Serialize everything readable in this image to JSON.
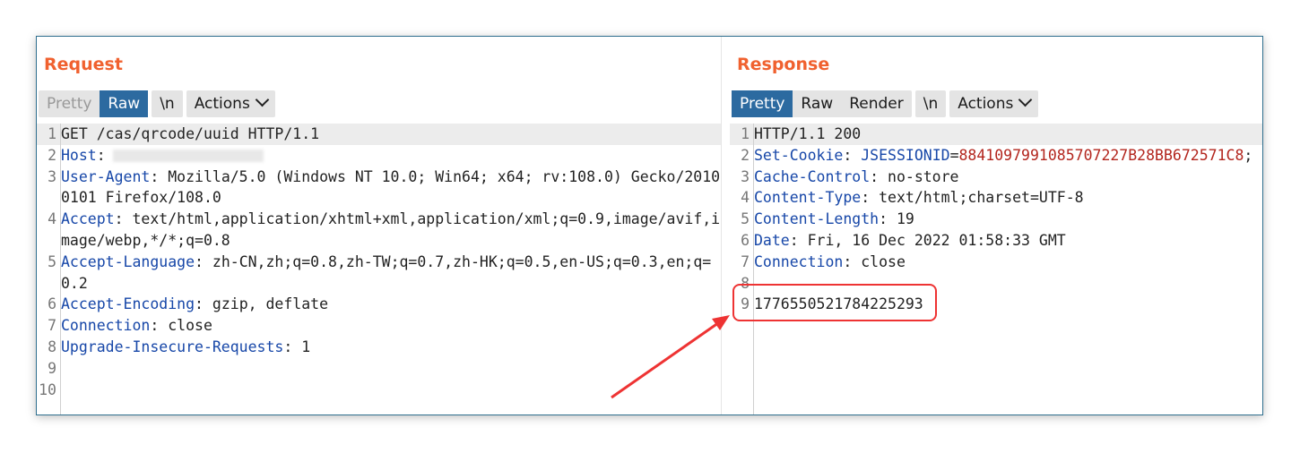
{
  "request": {
    "title": "Request",
    "buttons": {
      "pretty": "Pretty",
      "raw": "Raw",
      "newline": "\\n",
      "actions": "Actions"
    },
    "lines": [
      {
        "num": "1",
        "name": "",
        "sep": "",
        "value": "GET /cas/qrcode/uuid HTTP/1.1"
      },
      {
        "num": "2",
        "name": "Host",
        "sep": ":",
        "value": ""
      },
      {
        "num": "3",
        "name": "User-Agent",
        "sep": ":",
        "value": " Mozilla/5.0 (Windows NT 10.0; Win64; x64; rv:108.0) Gecko/20100101 Firefox/108.0"
      },
      {
        "num": "4",
        "name": "Accept",
        "sep": ":",
        "value": " text/html,application/xhtml+xml,application/xml;q=0.9,image/avif,image/webp,*/*;q=0.8"
      },
      {
        "num": "5",
        "name": "Accept-Language",
        "sep": ":",
        "value": " zh-CN,zh;q=0.8,zh-TW;q=0.7,zh-HK;q=0.5,en-US;q=0.3,en;q=0.2"
      },
      {
        "num": "6",
        "name": "Accept-Encoding",
        "sep": ":",
        "value": " gzip, deflate"
      },
      {
        "num": "7",
        "name": "Connection",
        "sep": ":",
        "value": " close"
      },
      {
        "num": "8",
        "name": "Upgrade-Insecure-Requests",
        "sep": ":",
        "value": " 1"
      },
      {
        "num": "9",
        "name": "",
        "sep": "",
        "value": ""
      },
      {
        "num": "10",
        "name": "",
        "sep": "",
        "value": ""
      }
    ]
  },
  "response": {
    "title": "Response",
    "buttons": {
      "pretty": "Pretty",
      "raw": "Raw",
      "render": "Render",
      "newline": "\\n",
      "actions": "Actions"
    },
    "lines": [
      {
        "num": "1",
        "name": "",
        "sep": "",
        "value": "HTTP/1.1 200"
      },
      {
        "num": "2",
        "name": "Set-Cookie",
        "sep": ":",
        "value": " ",
        "cookie_name": "JSESSIONID",
        "cookie_eq": "=",
        "cookie_value": "8841097991085707227B28BB672571C8",
        "cookie_end": ";"
      },
      {
        "num": "3",
        "name": "Cache-Control",
        "sep": ":",
        "value": " no-store"
      },
      {
        "num": "4",
        "name": "Content-Type",
        "sep": ":",
        "value": " text/html;charset=UTF-8"
      },
      {
        "num": "5",
        "name": "Content-Length",
        "sep": ":",
        "value": " 19"
      },
      {
        "num": "6",
        "name": "Date",
        "sep": ":",
        "value": " Fri, 16 Dec 2022 01:58:33 GMT"
      },
      {
        "num": "7",
        "name": "Connection",
        "sep": ":",
        "value": " close"
      },
      {
        "num": "8",
        "name": "",
        "sep": "",
        "value": ""
      },
      {
        "num": "9",
        "name": "",
        "sep": "",
        "value": "1776550521784225293"
      }
    ]
  },
  "colors": {
    "title": "#f0612f",
    "active_tab": "#2c6aa0",
    "header_name": "#1747a8",
    "cookie_value": "#b3261e",
    "annotation": "#e33"
  }
}
